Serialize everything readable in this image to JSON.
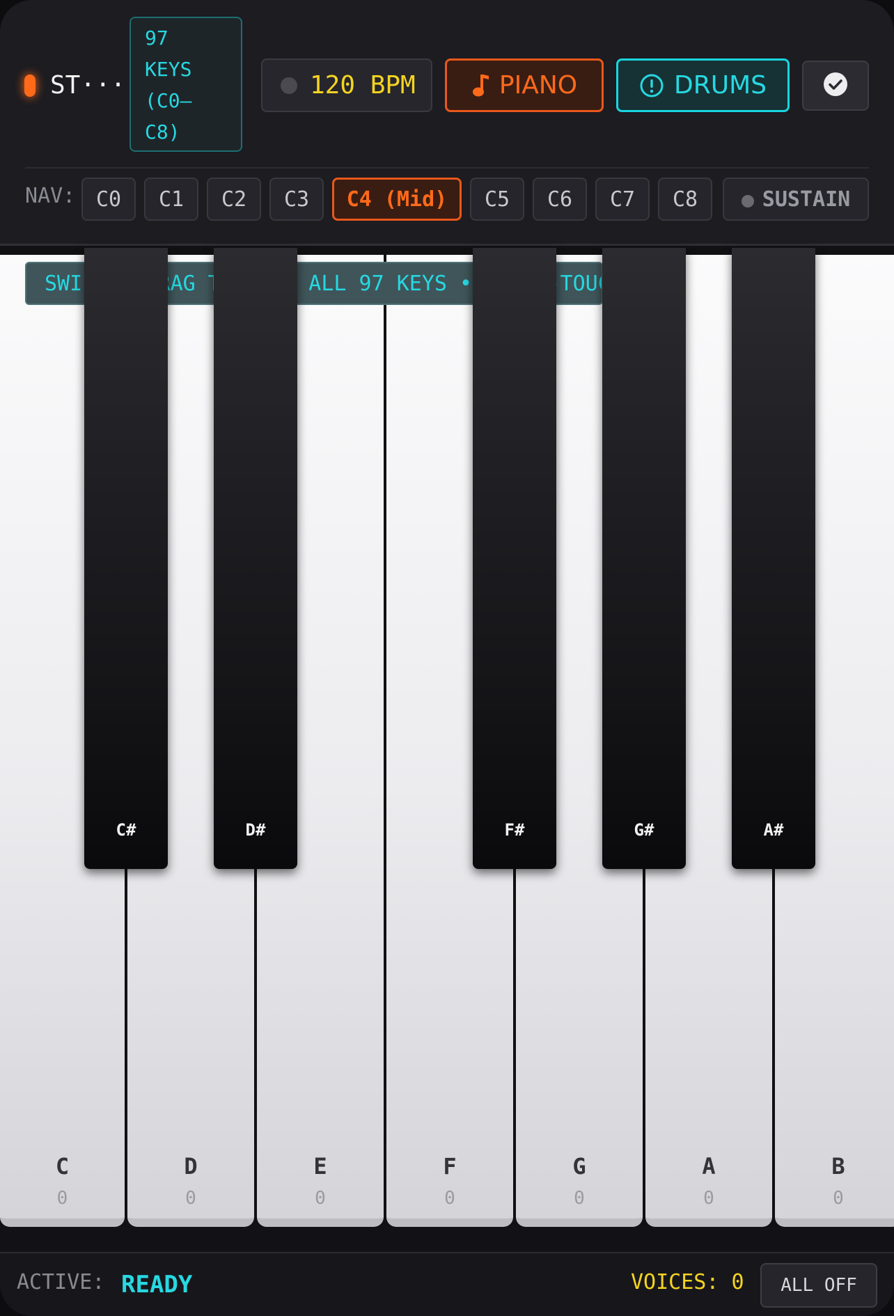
{
  "header": {
    "title": "ST···",
    "keys_line1": "97",
    "keys_line2": "KEYS",
    "keys_line3": "(C0–",
    "keys_line4": "C8)",
    "bpm_label": "120 BPM",
    "piano_label": "PIANO",
    "piano_icon": "music-note-icon",
    "drums_label": "DRUMS",
    "drums_icon": "alert-circle-icon",
    "confirm_icon": "check-circle-icon",
    "accent_color": "#ff6a1a",
    "secondary_color": "#27d8e2",
    "bpm_color": "#f5d422"
  },
  "nav": {
    "label": "NAV:",
    "octaves": [
      "C0",
      "C1",
      "C2",
      "C3",
      "C4 (Mid)",
      "C5",
      "C6",
      "C7",
      "C8"
    ],
    "selected": "C4 (Mid)",
    "sustain_label": "SUSTAIN"
  },
  "keyboard": {
    "hint": "SWIPE • DRAG TO PLAY ALL 97 KEYS • MULTI-TOUCH",
    "white_keys": [
      {
        "note": "C",
        "count": "0"
      },
      {
        "note": "D",
        "count": "0"
      },
      {
        "note": "E",
        "count": "0"
      },
      {
        "note": "F",
        "count": "0"
      },
      {
        "note": "G",
        "count": "0"
      },
      {
        "note": "A",
        "count": "0"
      },
      {
        "note": "B",
        "count": "0"
      }
    ],
    "black_keys": [
      {
        "note": "C#"
      },
      {
        "note": "D#"
      },
      {
        "note": "F#"
      },
      {
        "note": "G#"
      },
      {
        "note": "A#"
      }
    ]
  },
  "footer": {
    "active_label": "ACTIVE:",
    "active_value": "READY",
    "voices_label": "VOICES: 0",
    "all_off_label": "ALL OFF"
  }
}
